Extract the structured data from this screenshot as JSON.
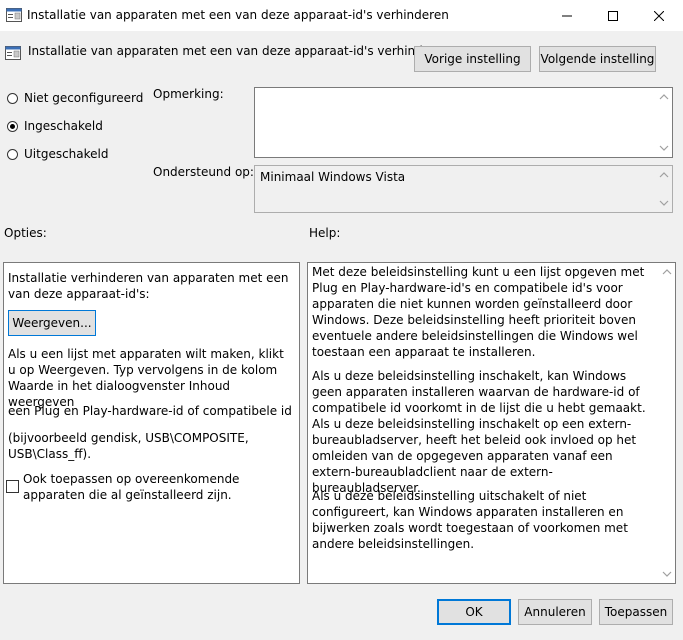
{
  "window": {
    "title": "Installatie van apparaten met een van deze apparaat-id's verhinderen"
  },
  "header": {
    "policy_title": "Installatie van apparaten met een van deze apparaat-id's verhinderen",
    "prev_button": "Vorige instelling",
    "next_button": "Volgende instelling"
  },
  "state": {
    "options": [
      {
        "label": "Niet geconfigureerd",
        "checked": false
      },
      {
        "label": "Ingeschakeld",
        "checked": true
      },
      {
        "label": "Uitgeschakeld",
        "checked": false
      }
    ]
  },
  "comment": {
    "label": "Opmerking:",
    "value": ""
  },
  "supported": {
    "label": "Ondersteund op:",
    "value": "Minimaal Windows Vista"
  },
  "options_panel": {
    "heading": "Opties:",
    "intro": "Installatie verhinderen van apparaten met een van deze apparaat-id's:",
    "show_button": "Weergeven...",
    "para1": "Als u een lijst met apparaten wilt maken, klikt u op Weergeven. Typ vervolgens in de kolom Waarde in het dialoogvenster Inhoud weergeven",
    "para2": "een Plug en Play-hardware-id of compatibele id",
    "para3": "(bijvoorbeeld gendisk, USB\\COMPOSITE, USB\\Class_ff).",
    "checkbox_label": "Ook toepassen op overeenkomende apparaten die al geïnstalleerd zijn.",
    "checkbox_checked": false
  },
  "help_panel": {
    "heading": "Help:",
    "para1": "Met deze beleidsinstelling kunt u een lijst opgeven met Plug en Play-hardware-id's en compatibele id's voor apparaten die niet kunnen worden geïnstalleerd door Windows. Deze beleidsinstelling heeft prioriteit boven eventuele andere beleidsinstellingen die Windows wel toestaan een apparaat te installeren.",
    "para2": "Als u deze beleidsinstelling inschakelt, kan Windows geen apparaten installeren waarvan de hardware-id of compatibele id voorkomt in de lijst die u hebt gemaakt. Als u deze beleidsinstelling inschakelt op een extern-bureaubladserver, heeft het beleid ook invloed op het omleiden van de opgegeven apparaten vanaf een extern-bureaubladclient naar de extern-bureaubladserver.",
    "para3": "Als u deze beleidsinstelling uitschakelt of niet configureert, kan Windows apparaten installeren en bijwerken zoals wordt toegestaan of voorkomen met andere beleidsinstellingen."
  },
  "footer": {
    "ok": "OK",
    "cancel": "Annuleren",
    "apply": "Toepassen"
  },
  "colors": {
    "window_bg": "#f0f0f0",
    "accent": "#0078d7"
  },
  "icons": [
    "policy-icon",
    "minimize-icon",
    "maximize-icon",
    "close-icon",
    "scroll-up-arrow-icon",
    "scroll-down-arrow-icon"
  ]
}
